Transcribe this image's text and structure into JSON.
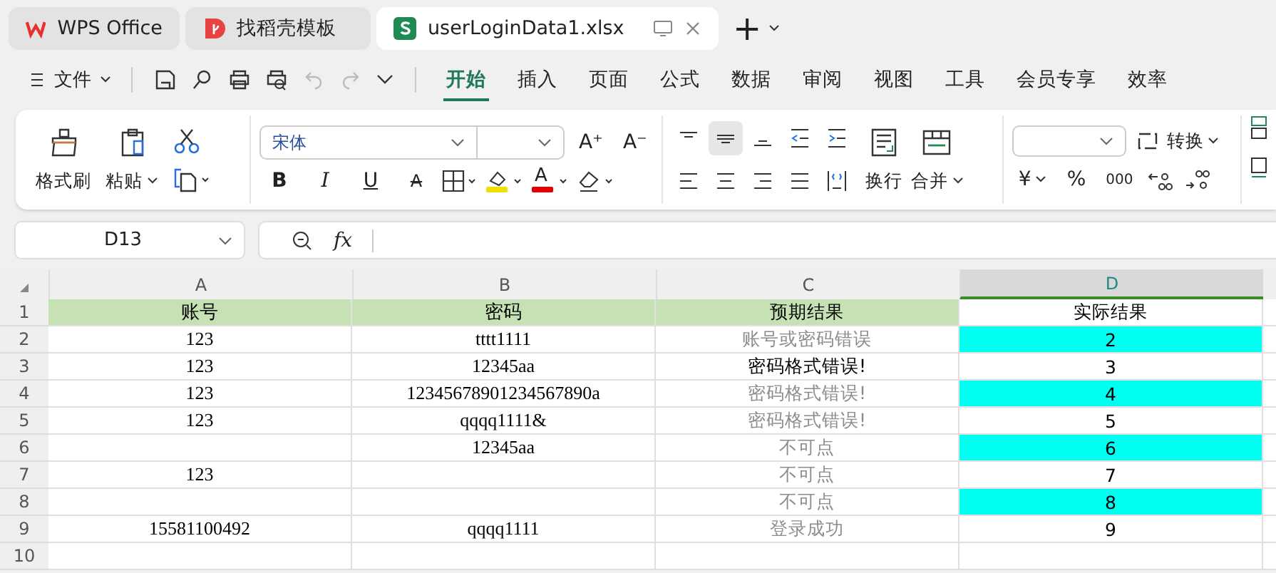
{
  "tabs": [
    {
      "label": "WPS Office",
      "kind": "home",
      "selected": false
    },
    {
      "label": "找稻壳模板",
      "kind": "template",
      "selected": false
    },
    {
      "label": "userLoginData1.xlsx",
      "kind": "sheet",
      "selected": true
    }
  ],
  "new_tab": "+",
  "menu": {
    "file": "文件",
    "tabs": [
      {
        "label": "开始",
        "selected": true
      },
      {
        "label": "插入",
        "selected": false
      },
      {
        "label": "页面",
        "selected": false
      },
      {
        "label": "公式",
        "selected": false
      },
      {
        "label": "数据",
        "selected": false
      },
      {
        "label": "审阅",
        "selected": false
      },
      {
        "label": "视图",
        "selected": false
      },
      {
        "label": "工具",
        "selected": false
      },
      {
        "label": "会员专享",
        "selected": false
      },
      {
        "label": "效率",
        "selected": false
      }
    ]
  },
  "ribbon": {
    "format_painter": "格式刷",
    "paste": "粘贴",
    "font": "宋体",
    "grow": "A⁺",
    "shrink": "A⁻",
    "styles": [
      {
        "text": "B",
        "kind": "bold"
      },
      {
        "text": "I",
        "kind": "italic"
      },
      {
        "text": "U",
        "kind": "underline"
      },
      {
        "text": "A",
        "kind": "strike"
      }
    ],
    "font_color": "A",
    "wrap": "换行",
    "merge": "合并",
    "convert": "转换",
    "currency": "¥",
    "percent": "%",
    "thousands": "000"
  },
  "name_box": "D13",
  "fx": "fx",
  "sheet": {
    "columns": [
      {
        "label": "A",
        "selected": false
      },
      {
        "label": "B",
        "selected": false
      },
      {
        "label": "C",
        "selected": false
      },
      {
        "label": "D",
        "selected": true
      }
    ],
    "rows": [
      {
        "number": "1",
        "cells": [
          {
            "text": "账号",
            "muted": false,
            "color": "#c6e2b5"
          },
          {
            "text": "密码",
            "muted": false,
            "color": "#c6e2b5"
          },
          {
            "text": "预期结果",
            "muted": false,
            "color": "#c6e2b5"
          },
          {
            "text": "实际结果",
            "muted": false
          }
        ]
      },
      {
        "number": "2",
        "cells": [
          {
            "text": "123",
            "muted": false
          },
          {
            "text": "tttt1111",
            "muted": false
          },
          {
            "text": "账号或密码错误",
            "muted": true
          },
          {
            "text": "2",
            "muted": false,
            "color": "#00fff0"
          }
        ]
      },
      {
        "number": "3",
        "cells": [
          {
            "text": "123",
            "muted": false
          },
          {
            "text": "12345aa",
            "muted": false
          },
          {
            "text": "密码格式错误!",
            "muted": false
          },
          {
            "text": "3",
            "muted": false
          }
        ]
      },
      {
        "number": "4",
        "cells": [
          {
            "text": "123",
            "muted": false
          },
          {
            "text": "12345678901234567890a",
            "muted": false
          },
          {
            "text": "密码格式错误!",
            "muted": true
          },
          {
            "text": "4",
            "muted": false,
            "color": "#00fff0"
          }
        ]
      },
      {
        "number": "5",
        "cells": [
          {
            "text": "123",
            "muted": false
          },
          {
            "text": "qqqq1111&",
            "muted": false
          },
          {
            "text": "密码格式错误!",
            "muted": true
          },
          {
            "text": "5",
            "muted": false
          }
        ]
      },
      {
        "number": "6",
        "cells": [
          {},
          {
            "text": "12345aa",
            "muted": false
          },
          {
            "text": "不可点",
            "muted": true
          },
          {
            "text": "6",
            "muted": false,
            "color": "#00fff0"
          }
        ]
      },
      {
        "number": "7",
        "cells": [
          {
            "text": "123",
            "muted": false
          },
          {},
          {
            "text": "不可点",
            "muted": true
          },
          {
            "text": "7",
            "muted": false
          }
        ]
      },
      {
        "number": "8",
        "cells": [
          {},
          {},
          {
            "text": "不可点",
            "muted": true
          },
          {
            "text": "8",
            "muted": false,
            "color": "#00fff0"
          }
        ]
      },
      {
        "number": "9",
        "cells": [
          {
            "text": "15581100492",
            "muted": false
          },
          {
            "text": "qqqq1111",
            "muted": false
          },
          {
            "text": "登录成功",
            "muted": true
          },
          {
            "text": "9",
            "muted": false
          }
        ]
      },
      {
        "number": "10",
        "cells": [
          {},
          {},
          {},
          {}
        ]
      }
    ]
  }
}
